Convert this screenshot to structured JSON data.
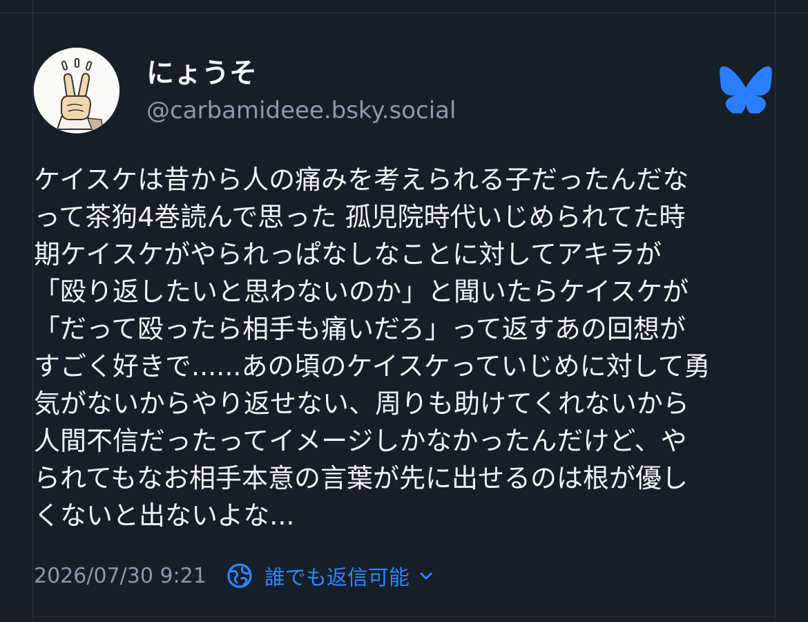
{
  "post": {
    "author": {
      "display_name": "にょうそ",
      "handle": "@carbamideee.bsky.social",
      "avatar_icon": "peace-sign-hand-icon"
    },
    "brand_icon": "bluesky-butterfly-icon",
    "text_lines": [
      "ケイスケは昔から人の痛みを考えられる子だったんだな",
      "って茶狗4巻読んで思った 孤児院時代いじめられてた時",
      "期ケイスケがやられっぱなしなことに対してアキラが",
      "「殴り返したいと思わないのか」と聞いたらケイスケが",
      "「だって殴ったら相手も痛いだろ」って返すあの回想が",
      "すごく好きで......あの頃のケイスケっていじめに対して勇",
      "気がないからやり返せない、周りも助けてくれないから",
      "人間不信だったってイメージしかなかったんだけど、や",
      "られてもなお相手本意の言葉が先に出せるのは根が優し",
      "くないと出ないよな..."
    ],
    "timestamp": "2026/07/30 9:21",
    "reply_settings": {
      "label": "誰でも返信可能",
      "icon": "globe-reply-icon",
      "dropdown_icon": "chevron-down-icon"
    }
  },
  "colors": {
    "background": "#161e27",
    "text_primary": "#f1f3f5",
    "text_secondary": "#8d9aab",
    "accent": "#2f86ff",
    "brand": "#2b7fff"
  }
}
